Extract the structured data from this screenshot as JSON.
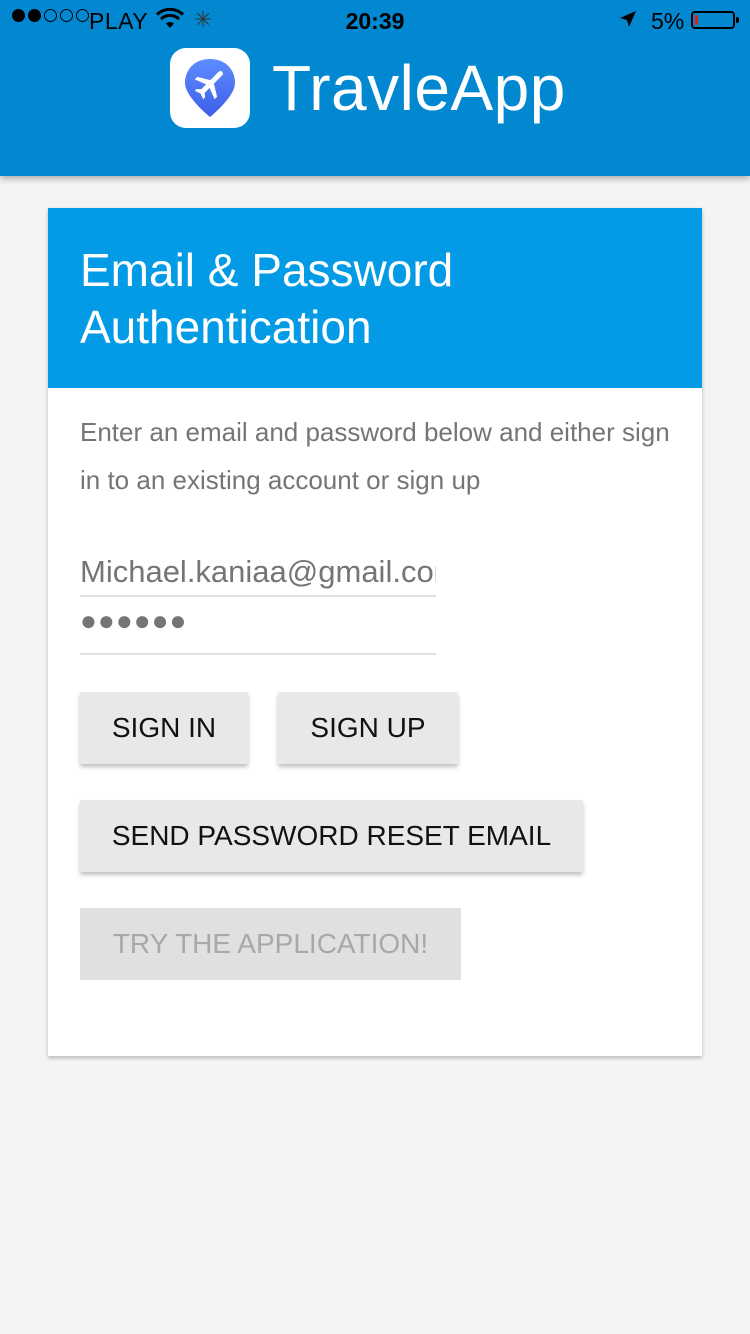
{
  "status_bar": {
    "carrier": "PLAY",
    "time": "20:39",
    "battery_percent": "5%",
    "signal_bars_filled": 2,
    "signal_bars_total": 5
  },
  "header": {
    "app_name": "TravleApp",
    "logo_icon": "airplane-pin-icon",
    "color": "#0288d1"
  },
  "auth_card": {
    "title": "Email & Password Authentication",
    "header_color": "#039be5",
    "intro_text": "Enter an email and password below and either sign in to an existing account or sign up",
    "email_value": "Michael.kaniaa@gmail.com",
    "password_value": "●●●●●●",
    "buttons": {
      "sign_in": "SIGN IN",
      "sign_up": "SIGN UP",
      "reset": "SEND PASSWORD RESET EMAIL",
      "try_app": "TRY THE APPLICATION!"
    }
  }
}
